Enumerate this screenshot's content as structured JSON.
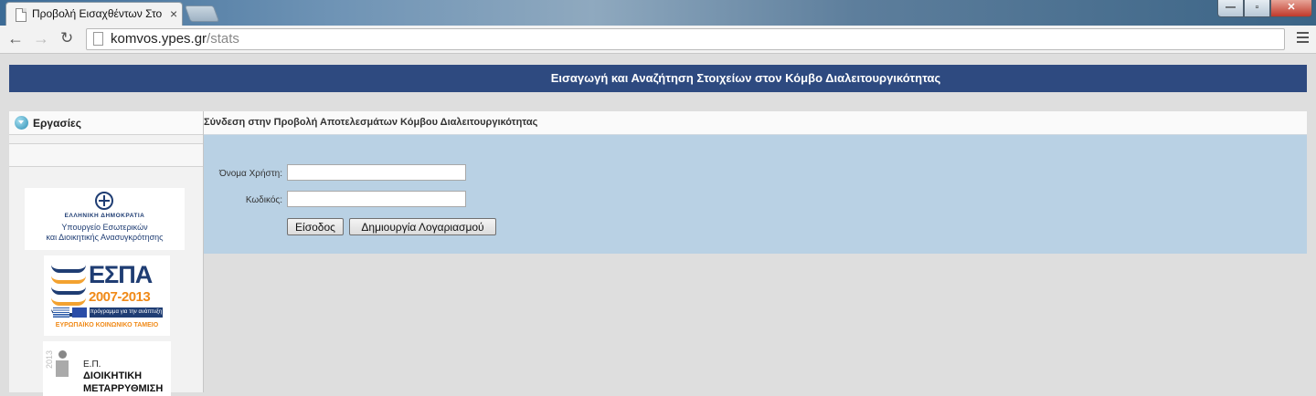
{
  "browser": {
    "tab_title": "Προβολή Εισαχθέντων Στο",
    "tab_close": "×",
    "window_controls": {
      "minimize": "—",
      "maximize": "▫",
      "close": "✕"
    },
    "url_host": "komvos.ypes.gr",
    "url_path": "/stats",
    "icons": [
      "back-arrow-icon",
      "forward-arrow-icon",
      "reload-icon",
      "page-icon",
      "menu-icon"
    ]
  },
  "header": {
    "banner_title": "Εισαγωγή και Αναζήτηση Στοιχείων στον Κόμβο Διαλειτουργικότητας"
  },
  "sidebar": {
    "title": "Εργασίες",
    "logos": {
      "ministry": {
        "line1": "ΕΛΛΗΝΙΚΗ ΔΗΜΟΚΡΑΤΙΑ",
        "line2": "Υπουργείο Εσωτερικών",
        "line3": "και Διοικητικής Ανασυγκρότησης"
      },
      "espa": {
        "title": "ΕΣΠΑ",
        "years": "2007-2013",
        "program": "πρόγραμμα για την ανάπτυξη",
        "fund": "ΕΥΡΩΠΑΪΚΟ ΚΟΙΝΩΝΙΚΟ ΤΑΜΕΙΟ"
      },
      "ep": {
        "year": "2013",
        "line1": "Ε.Π.",
        "line2": "ΔΙΟΙΚΗΤΙΚΗ",
        "line3": "ΜΕΤΑΡΡΥΘΜΙΣΗ"
      }
    }
  },
  "main": {
    "title": "Σύνδεση στην Προβολή Αποτελεσμάτων Κόμβου Διαλειτουργικότητας",
    "form": {
      "username_label": "Όνομα Χρήστη:",
      "username_value": "",
      "password_label": "Κωδικός:",
      "password_value": "",
      "login_button": "Είσοδος",
      "create_account_button": "Δημιουργία Λογαριασμού"
    }
  },
  "colors": {
    "banner": "#2e4a80",
    "form_panel": "#b9d1e4",
    "page_background": "#dedede"
  }
}
